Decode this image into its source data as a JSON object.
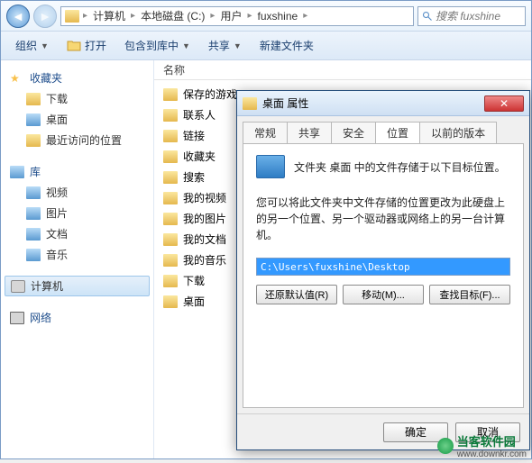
{
  "breadcrumb": {
    "root": "计算机",
    "drive": "本地磁盘 (C:)",
    "users": "用户",
    "user": "fuxshine"
  },
  "search": {
    "placeholder": "搜索 fuxshine"
  },
  "toolbar": {
    "organize": "组织",
    "open": "打开",
    "include": "包含到库中",
    "share": "共享",
    "newfolder": "新建文件夹"
  },
  "sidebar": {
    "favorites": {
      "head": "收藏夹",
      "items": [
        "下载",
        "桌面",
        "最近访问的位置"
      ]
    },
    "libraries": {
      "head": "库",
      "items": [
        "视频",
        "图片",
        "文档",
        "音乐"
      ]
    },
    "computer": "计算机",
    "network": "网络"
  },
  "columns": {
    "name": "名称"
  },
  "files": [
    "保存的游戏",
    "联系人",
    "链接",
    "收藏夹",
    "搜索",
    "我的视频",
    "我的图片",
    "我的文档",
    "我的音乐",
    "下载",
    "桌面"
  ],
  "dialog": {
    "title": "桌面 属性",
    "tabs": {
      "general": "常规",
      "sharing": "共享",
      "security": "安全",
      "location": "位置",
      "previous": "以前的版本"
    },
    "line1": "文件夹 桌面 中的文件存储于以下目标位置。",
    "line2": "您可以将此文件夹中文件存储的位置更改为此硬盘上的另一个位置、另一个驱动器或网络上的另一台计算机。",
    "path": "C:\\Users\\fuxshine\\Desktop",
    "btn_restore": "还原默认值(R)",
    "btn_move": "移动(M)...",
    "btn_find": "查找目标(F)...",
    "ok": "确定",
    "cancel": "取消"
  },
  "watermark": {
    "name": "当客软件园",
    "url": "www.downkr.com"
  }
}
